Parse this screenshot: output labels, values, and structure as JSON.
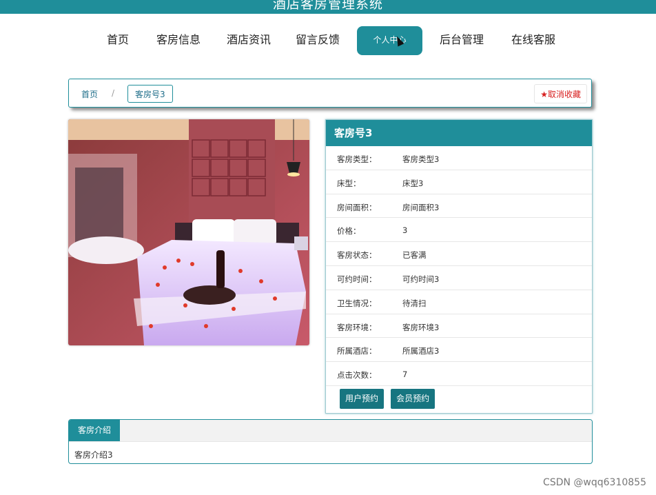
{
  "app": {
    "title": "酒店客房管理系统"
  },
  "nav": {
    "items": [
      {
        "label": "首页"
      },
      {
        "label": "客房信息"
      },
      {
        "label": "酒店资讯"
      },
      {
        "label": "留言反馈"
      },
      {
        "label": "个人中心",
        "active": true
      },
      {
        "label": "后台管理"
      },
      {
        "label": "在线客服"
      }
    ]
  },
  "breadcrumb": {
    "home": "首页",
    "separator": "/",
    "current": "客房号3",
    "favorite_label": "取消收藏",
    "favorite_icon": "star-icon"
  },
  "room": {
    "title": "客房号3",
    "fields": [
      {
        "key": "客房类型：",
        "value": "客房类型3"
      },
      {
        "key": "床型：",
        "value": "床型3"
      },
      {
        "key": "房间面积：",
        "value": "房间面积3"
      },
      {
        "key": "价格：",
        "value": "3"
      },
      {
        "key": "客房状态：",
        "value": "已客满"
      },
      {
        "key": "可约时间：",
        "value": "可约时间3"
      },
      {
        "key": "卫生情况：",
        "value": "待清扫"
      },
      {
        "key": "客房环境：",
        "value": "客房环境3"
      },
      {
        "key": "所属酒店：",
        "value": "所属酒店3"
      },
      {
        "key": "点击次数：",
        "value": "7"
      }
    ],
    "buttons": {
      "user_booking": "用户预约",
      "member_booking": "会员预约"
    }
  },
  "intro": {
    "tab_label": "客房介绍",
    "content": "客房介绍3"
  },
  "watermark": "CSDN @wqq6310855",
  "colors": {
    "primary": "#1f8e9a",
    "button": "#177580",
    "favorite": "#d71f1f"
  }
}
